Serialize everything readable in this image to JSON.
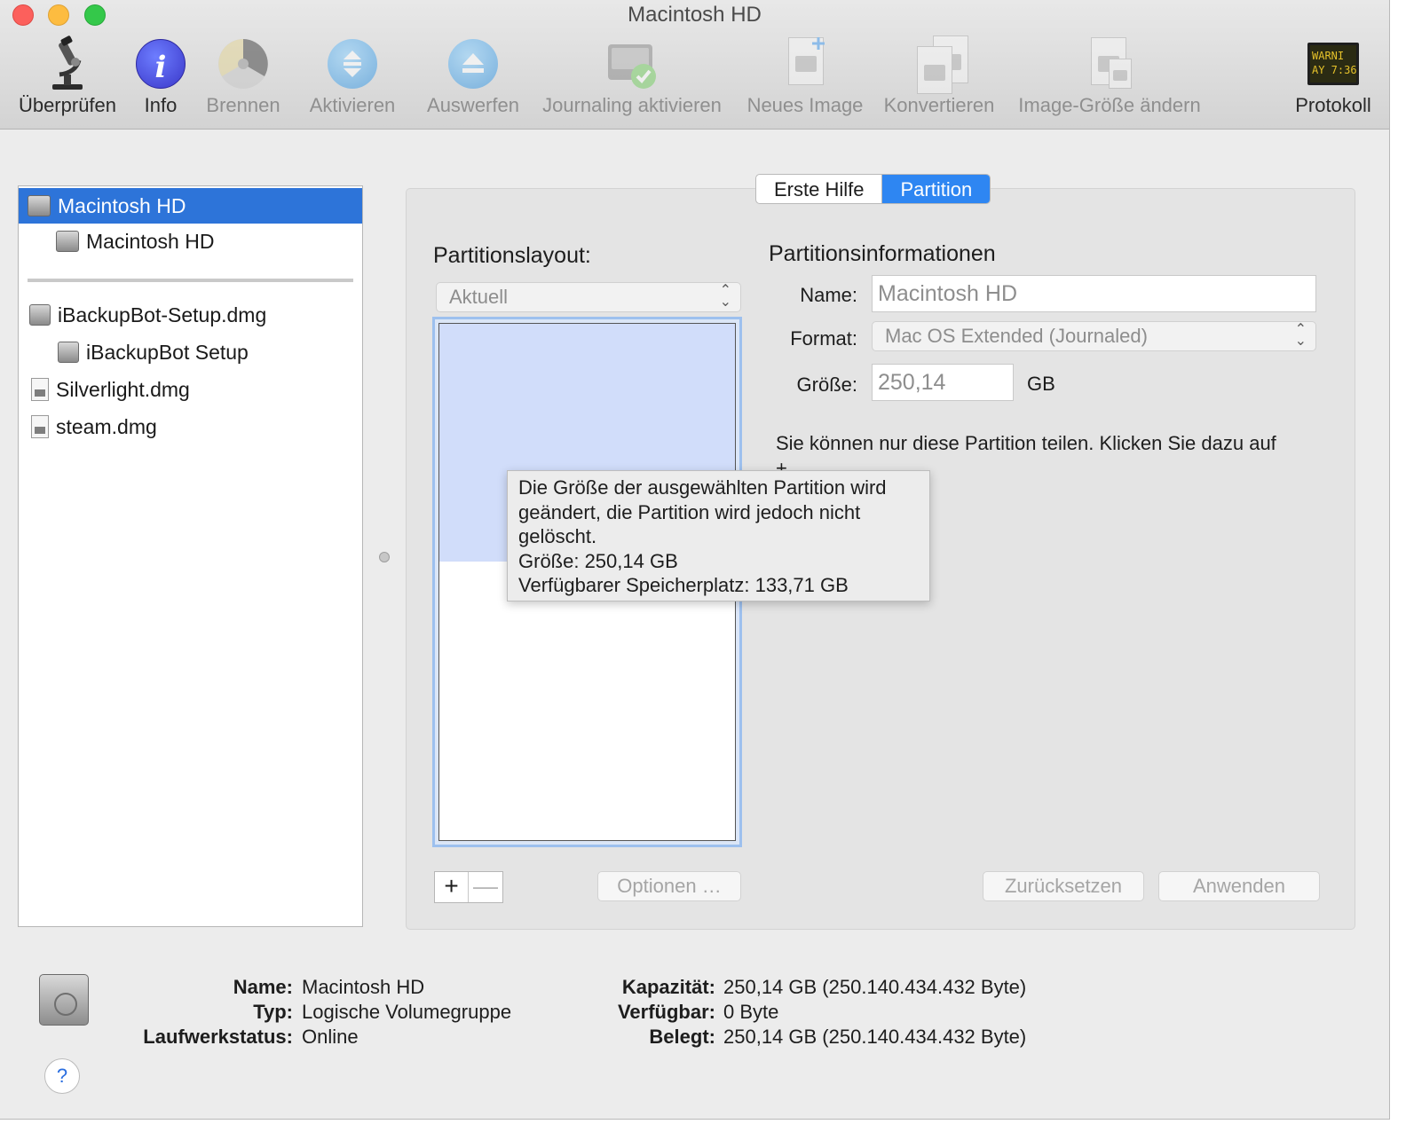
{
  "window": {
    "title": "Macintosh HD"
  },
  "toolbar": {
    "items": [
      {
        "label": "Überprüfen",
        "icon": "microscope-icon",
        "enabled": true
      },
      {
        "label": "Info",
        "icon": "info-icon",
        "enabled": true
      },
      {
        "label": "Brennen",
        "icon": "burn-icon",
        "enabled": false
      },
      {
        "label": "Aktivieren",
        "icon": "mount-icon",
        "enabled": false
      },
      {
        "label": "Auswerfen",
        "icon": "eject-icon",
        "enabled": false
      },
      {
        "label": "Journaling aktivieren",
        "icon": "journaling-icon",
        "enabled": false
      },
      {
        "label": "Neues Image",
        "icon": "new-image-icon",
        "enabled": false
      },
      {
        "label": "Konvertieren",
        "icon": "convert-icon",
        "enabled": false
      },
      {
        "label": "Image-Größe ändern",
        "icon": "resize-image-icon",
        "enabled": false
      },
      {
        "label": "Protokoll",
        "icon": "log-icon",
        "enabled": true
      }
    ],
    "log_icon_text": [
      "WARNI",
      "AY 7:36"
    ]
  },
  "sidebar": {
    "items": [
      {
        "label": "Macintosh HD",
        "icon": "drive-icon",
        "selected": true
      },
      {
        "label": "Macintosh HD",
        "icon": "volume-icon",
        "selected": false
      },
      {
        "label": "iBackupBot-Setup.dmg",
        "icon": "disk-image-icon",
        "selected": false
      },
      {
        "label": "iBackupBot Setup",
        "icon": "volume-icon",
        "selected": false
      },
      {
        "label": "Silverlight.dmg",
        "icon": "dmg-file-icon",
        "selected": false
      },
      {
        "label": "steam.dmg",
        "icon": "dmg-file-icon",
        "selected": false
      }
    ]
  },
  "tabs": [
    {
      "label": "Erste Hilfe",
      "active": false
    },
    {
      "label": "Partition",
      "active": true
    }
  ],
  "partition": {
    "layout_heading": "Partitionslayout:",
    "layout_select": "Aktuell",
    "used_fraction": 0.46,
    "info_heading": "Partitionsinformationen",
    "name_label": "Name:",
    "name_value": "Macintosh HD",
    "format_label": "Format:",
    "format_value": "Mac OS Extended (Journaled)",
    "size_label": "Größe:",
    "size_value": "250,14",
    "size_unit": "GB",
    "hint_line1": "Sie können nur diese Partition teilen. Klicken Sie dazu auf",
    "hint_line2": "+"
  },
  "tooltip": {
    "lines": [
      "Die Größe der ausgewählten Partition wird",
      "geändert, die Partition wird jedoch nicht",
      "gelöscht.",
      "Größe: 250,14 GB",
      "Verfügbarer Speicherplatz: 133,71 GB"
    ]
  },
  "buttons": {
    "plus": "+",
    "minus": "—",
    "options": "Optionen …",
    "reset": "Zurücksetzen",
    "apply": "Anwenden",
    "help": "?"
  },
  "disk_info": {
    "name_key": "Name",
    "name_value": "Macintosh HD",
    "type_key": "Typ",
    "type_value": "Logische Volumegruppe",
    "status_key": "Laufwerkstatus",
    "status_value": "Online",
    "capacity_key": "Kapazität",
    "capacity_value": "250,14 GB (250.140.434.432 Byte)",
    "available_key": "Verfügbar",
    "available_value": "0 Byte",
    "used_key": "Belegt",
    "used_value": "250,14 GB (250.140.434.432 Byte)"
  }
}
